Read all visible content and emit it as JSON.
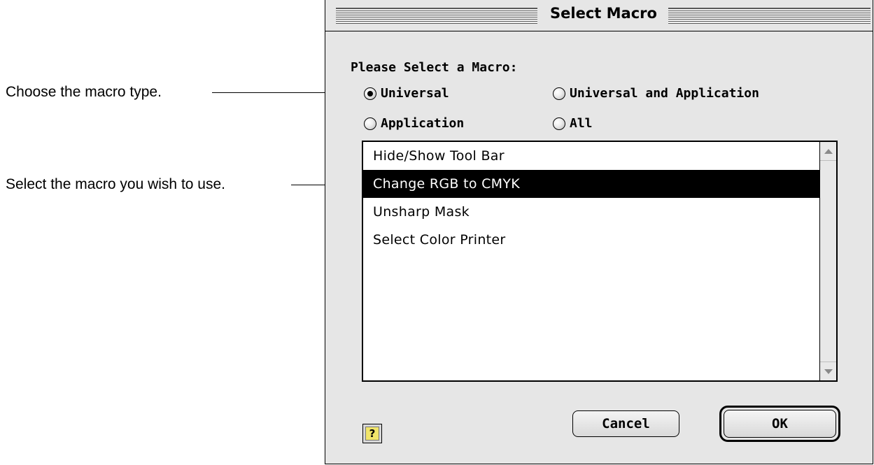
{
  "callouts": {
    "macro_type": "Choose the macro type.",
    "macro_select": "Select the macro you wish to use."
  },
  "dialog": {
    "title": "Select Macro",
    "prompt": "Please Select a Macro:",
    "radio_options": [
      {
        "label": "Universal",
        "selected": true
      },
      {
        "label": "Universal and Application",
        "selected": false
      },
      {
        "label": "Application",
        "selected": false
      },
      {
        "label": "All",
        "selected": false
      }
    ],
    "macro_list": [
      {
        "label": "Hide/Show Tool Bar",
        "selected": false
      },
      {
        "label": "Change RGB to CMYK",
        "selected": true
      },
      {
        "label": "Unsharp Mask",
        "selected": false
      },
      {
        "label": "Select Color Printer",
        "selected": false
      }
    ],
    "help_icon": "?",
    "cancel_label": "Cancel",
    "ok_label": "OK"
  }
}
